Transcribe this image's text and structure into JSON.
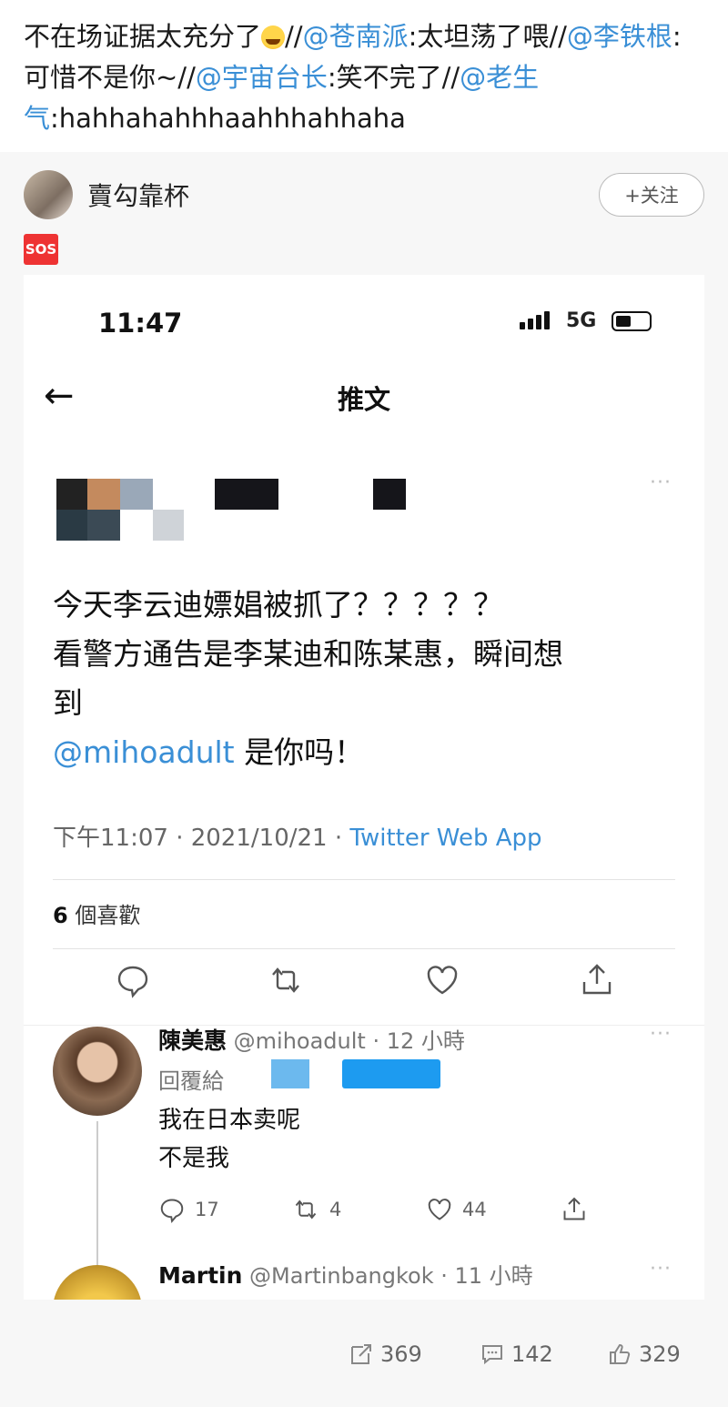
{
  "repost": {
    "part1": "不在场证据太充分了",
    "emoji": "laughing-crying-emoji",
    "sep1": "//",
    "at1": "@苍南派",
    "text1": ":太坦荡了喂//",
    "at2": "@李铁根",
    "text2": ":可惜不是你~//",
    "at3": "@宇宙台长",
    "text3": ":笑不完了//",
    "at4": "@老生气",
    "text4": ":hahhahahhhaahhhahhaha"
  },
  "post": {
    "username": "賣勾靠杯",
    "follow_label": "+关注",
    "sos_label": "SOS"
  },
  "screenshot": {
    "time": "11:47",
    "network": "5G",
    "nav_title": "推文",
    "back_label": "←",
    "tweet_line1": "今天李云迪嫖娼被抓了？？？？？",
    "tweet_line2": "看警方通告是李某迪和陈某惠，瞬间想",
    "tweet_line3": "到",
    "tweet_mention": "@mihoadult",
    "tweet_line4_suffix": " 是你吗！",
    "meta_time": "下午11:07 · 2021/10/21 · ",
    "meta_source": "Twitter Web App",
    "likes_count": "6",
    "likes_label": " 個喜歡",
    "reply": {
      "name": "陳美惠",
      "handle": " @mihoadult · 12 小時",
      "reply_to": "回覆給",
      "line1": "我在日本卖呢",
      "line2": "不是我",
      "comments": "17",
      "retweets": "4",
      "likes": "44"
    },
    "next_reply": {
      "name": "Martin",
      "handle": " @Martinbangkok · 11 小時"
    },
    "more_label": "···"
  },
  "footer": {
    "reposts": "369",
    "comments": "142",
    "likes": "329"
  },
  "colors": {
    "link": "#3a8fd6",
    "background": "#f7f7f7"
  }
}
